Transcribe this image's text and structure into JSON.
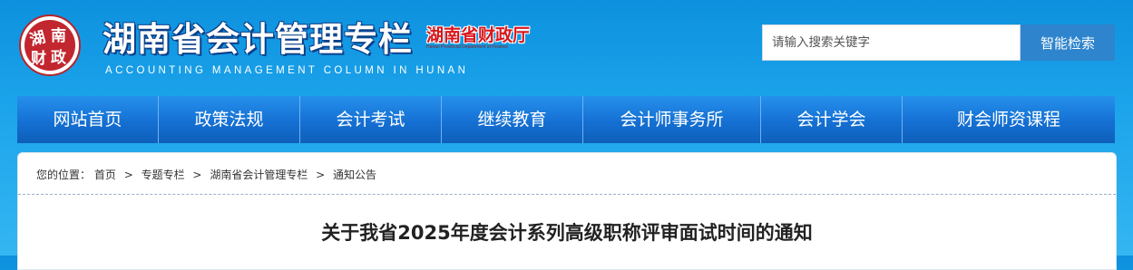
{
  "header": {
    "title": "湖南省会计管理专栏",
    "subtitle": "ACCOUNTING MANAGEMENT COLUMN IN HUNAN",
    "seal_text": [
      "湖",
      "南",
      "财",
      "政"
    ],
    "dept_logo": "湖南省财政厅",
    "dept_logo_small": "Hunan Provincial Department of Finance"
  },
  "search": {
    "placeholder": "请输入搜索关键字",
    "value": "",
    "button_label": "智能检索"
  },
  "nav": {
    "items": [
      {
        "label": "网站首页"
      },
      {
        "label": "政策法规"
      },
      {
        "label": "会计考试"
      },
      {
        "label": "继续教育"
      },
      {
        "label": "会计师事务所"
      },
      {
        "label": "会计学会"
      },
      {
        "label": "财会师资课程"
      }
    ]
  },
  "breadcrumb": {
    "prefix": "您的位置：",
    "items": [
      "首页",
      "专题专栏",
      "湖南省会计管理专栏",
      "通知公告"
    ],
    "separator": ">"
  },
  "article": {
    "title": "关于我省2025年度会计系列高级职称评审面试时间的通知"
  },
  "colors": {
    "header_bg": "#1ba3ea",
    "nav_bg": "#1570d3",
    "search_button": "#2e84cd",
    "seal_red": "#b3262b",
    "dept_red": "#d8161b"
  },
  "icons": {
    "logo": "hunan-finance-seal-icon"
  }
}
